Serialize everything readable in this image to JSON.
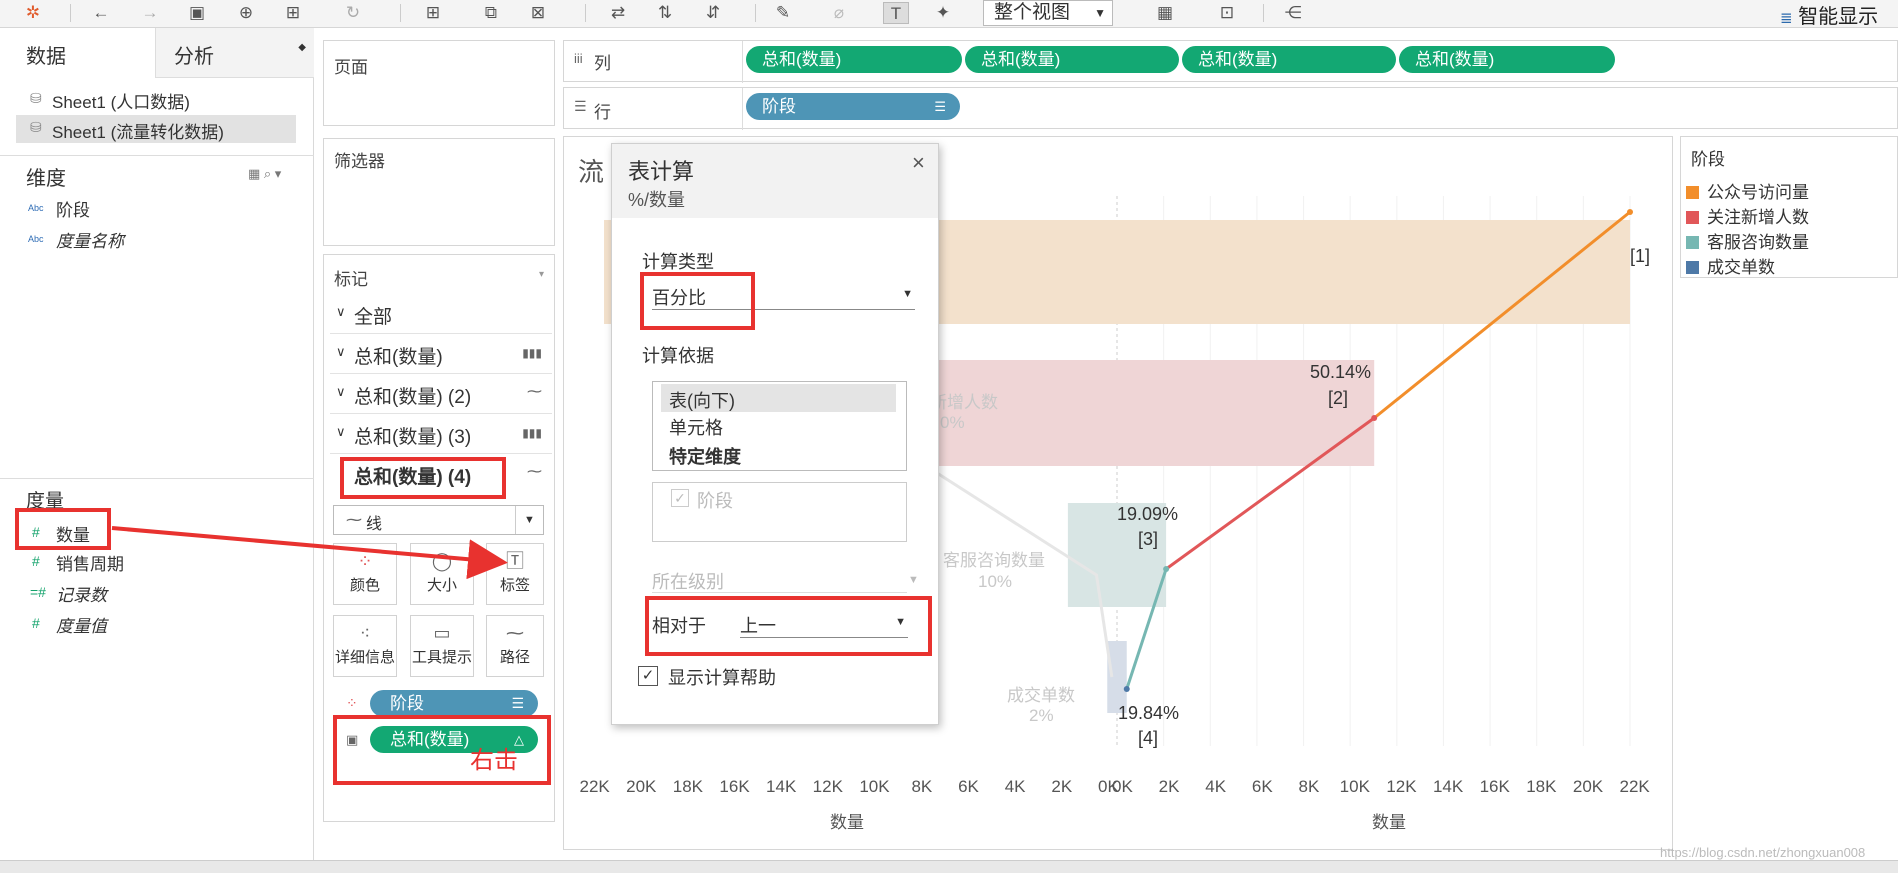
{
  "app": {
    "smart_show_label": "智能显示",
    "view_select": "整个视图"
  },
  "toolbar": {
    "icons": [
      "tableau-logo",
      "undo",
      "redo",
      "save",
      "new-datasource",
      "pause",
      "refresh",
      "new-worksheet",
      "duplicate",
      "clear",
      "swap",
      "sort-asc",
      "sort-desc",
      "highlight",
      "attach",
      "label",
      "pin",
      "fit",
      "chart",
      "presentation",
      "share"
    ]
  },
  "left": {
    "tab_data": "数据",
    "tab_analysis": "分析",
    "datasources": [
      "Sheet1 (人口数据)",
      "Sheet1 (流量转化数据)"
    ],
    "dimensions_header": "维度",
    "dimensions": [
      "阶段",
      "度量名称"
    ],
    "dim_type": "Abc",
    "measures_header": "度量",
    "measures": [
      "数量",
      "销售周期",
      "记录数",
      "度量值"
    ]
  },
  "shelves": {
    "pages": "页面",
    "filters": "筛选器",
    "columns_label": "列",
    "rows_label": "行",
    "columns_pills": [
      "总和(数量)",
      "总和(数量)",
      "总和(数量)",
      "总和(数量)"
    ],
    "rows_pill": "阶段"
  },
  "marks": {
    "header": "标记",
    "rows": [
      "全部",
      "总和(数量)",
      "总和(数量) (2)",
      "总和(数量) (3)",
      "总和(数量) (4)"
    ],
    "mark_type": "线",
    "buttons": [
      "颜色",
      "大小",
      "标签",
      "详细信息",
      "工具提示",
      "路径"
    ],
    "pill_stage": "阶段",
    "pill_sum": "总和(数量)",
    "annotation": "右击"
  },
  "dialog": {
    "title": "表计算",
    "subtitle": "%/数量",
    "calc_type_label": "计算类型",
    "calc_type_value": "百分比",
    "compute_using_label": "计算依据",
    "compute_options": [
      "表(向下)",
      "单元格",
      "特定维度"
    ],
    "dimension_check": "阶段",
    "level_label": "所在级别",
    "relative_label": "相对于",
    "relative_value": "上一",
    "show_help": "显示计算帮助",
    "close": "×"
  },
  "chart": {
    "title_partial": "流",
    "legend_title": "阶段",
    "axis_title_left": "数量",
    "axis_title_right": "数量",
    "axis_ticks_left": [
      "22K",
      "20K",
      "18K",
      "16K",
      "14K",
      "12K",
      "10K",
      "8K",
      "6K",
      "4K",
      "2K",
      "0K"
    ],
    "axis_ticks_right": [
      "0K",
      "2K",
      "4K",
      "6K",
      "8K",
      "10K",
      "12K",
      "14K",
      "16K",
      "18K",
      "20K",
      "22K"
    ],
    "faint_labels": [
      {
        "text": "新增人数",
        "sub": "0%"
      },
      {
        "text": "客服咨询数量",
        "sub": "10%"
      },
      {
        "text": "成交单数",
        "sub": "2%"
      }
    ],
    "point_labels": [
      "[1]",
      "50.14%",
      "[2]",
      "19.09%",
      "[3]",
      "19.84%",
      "[4]"
    ],
    "watermark": "https://blog.csdn.net/zhongxuan008"
  },
  "chart_data": {
    "type": "bar",
    "categories": [
      "公众号访问量",
      "关注新增人数",
      "客服咨询数量",
      "成交单数"
    ],
    "values": [
      22000,
      11030,
      2106,
      418
    ],
    "colors": [
      "#f28e2b",
      "#e15759",
      "#76b7b2",
      "#4e79a7"
    ],
    "line_percent_labels": [
      "",
      "50.14%",
      "19.09%",
      "19.84%"
    ],
    "index_labels": [
      "[1]",
      "[2]",
      "[3]",
      "[4]"
    ],
    "axis_range": [
      0,
      22000
    ]
  }
}
